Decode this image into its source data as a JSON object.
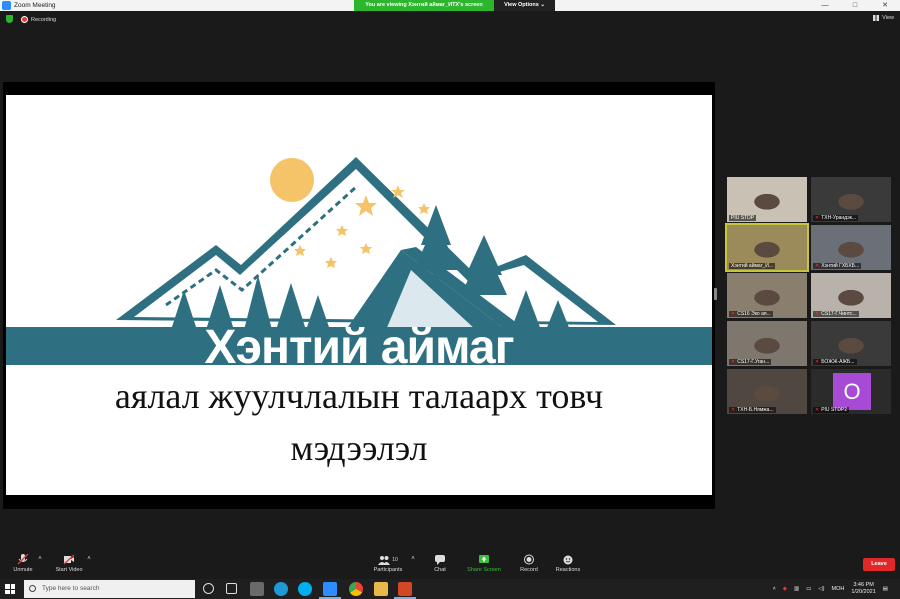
{
  "window": {
    "title": "Zoom Meeting",
    "viewing_banner": "You are viewing Хэнтий аймаг_ИТХ's screen",
    "view_options": "View Options ⌄",
    "controls": [
      "—",
      "□",
      "✕"
    ]
  },
  "meeting": {
    "recording_label": "Recording",
    "view_label": "View"
  },
  "slide": {
    "title": "Хэнтий аймаг",
    "subtitle_line1": "аялал жуулчлалын талаарх товч",
    "subtitle_line2": "мэдээлэл"
  },
  "gallery": [
    {
      "name": "PIU STDP",
      "muted": false,
      "bg": "#c9c2b4"
    },
    {
      "name": "ТХН-Урандэк...",
      "muted": true,
      "bg": "#3a3a3a"
    },
    {
      "name": "Хэнтий аймаг_И...",
      "muted": false,
      "bg": "#9b8a5a",
      "active": true
    },
    {
      "name": "Хэнтий ГХБХБ...",
      "muted": true,
      "bg": "#6b7078"
    },
    {
      "name": "CS16 Эко ая...",
      "muted": true,
      "bg": "#8a7e6e"
    },
    {
      "name": "CS17-Г.Чинтс...",
      "muted": true,
      "bg": "#b8b2aa"
    },
    {
      "name": "CS17-Г.Уган...",
      "muted": true,
      "bg": "#7d776e"
    },
    {
      "name": "БОЖЖ-АЖБ...",
      "muted": true,
      "bg": "#3a3a3a"
    },
    {
      "name": "ТХН-Б.Нямжа...",
      "muted": true,
      "bg": "#504741"
    },
    {
      "name": "PIU STDP2",
      "muted": true,
      "avatar": "O"
    }
  ],
  "toolbar": {
    "unmute": "Unmute",
    "start_video": "Start Video",
    "participants": "Participants",
    "participants_count": "10",
    "chat": "Chat",
    "share_screen": "Share Screen",
    "record": "Record",
    "reactions": "Reactions",
    "leave": "Leave"
  },
  "taskbar": {
    "search_placeholder": "Type here to search",
    "language": "МОН",
    "time": "3:46 PM",
    "date": "1/20/2021"
  },
  "colors": {
    "accent_green": "#2eb52e",
    "leave_red": "#e02828",
    "slide_teal": "#2e7081"
  }
}
